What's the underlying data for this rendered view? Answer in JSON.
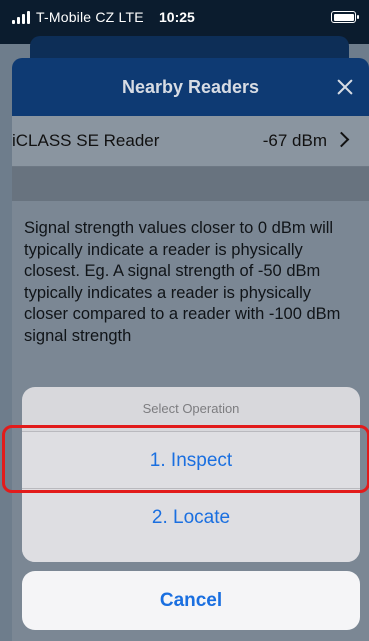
{
  "status_bar": {
    "carrier": "T-Mobile CZ  LTE",
    "time": "10:25",
    "signal_icon": "signal-bars-icon",
    "battery_icon": "battery-icon",
    "battery_level": 1.0
  },
  "nav": {
    "title": "Nearby Readers",
    "close_icon": "close-icon"
  },
  "reader": {
    "name": "iCLASS SE Reader",
    "signal": "-67 dBm",
    "chevron_icon": "chevron-right-icon"
  },
  "info_text": "Signal strength values closer to 0 dBm will typically indicate a reader is physically closest. Eg. A signal strength of -50 dBm typically indicates a reader is physically closer compared to a reader with -100 dBm signal strength",
  "action_sheet": {
    "title": "Select Operation",
    "items": [
      {
        "label": "1. Inspect"
      },
      {
        "label": "2. Locate"
      }
    ],
    "cancel_label": "Cancel"
  },
  "colors": {
    "accent": "#1a6fe0",
    "nav_bar": "#0e3a73",
    "highlight": "#e21b1b"
  }
}
